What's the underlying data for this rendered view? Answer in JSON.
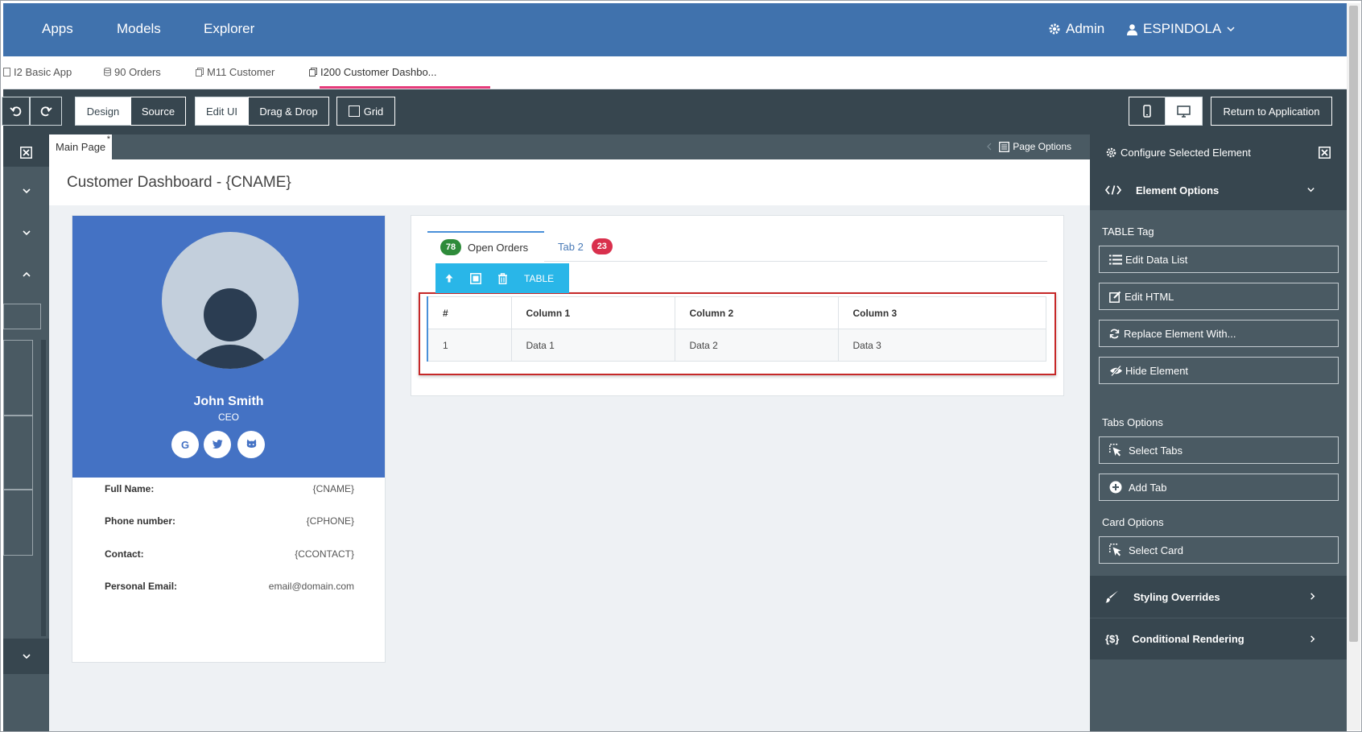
{
  "topnav": {
    "items": [
      "Apps",
      "Models",
      "Explorer"
    ],
    "admin_label": "Admin",
    "user_label": "ESPINDOLA"
  },
  "file_tabs": [
    {
      "label": "I2 Basic App",
      "icon": "file-icon"
    },
    {
      "label": "90 Orders",
      "icon": "database-icon"
    },
    {
      "label": "M11 Customer",
      "icon": "file-icon"
    },
    {
      "label": "I200 Customer Dashbo...",
      "icon": "file-icon",
      "active": true
    }
  ],
  "toolbar": {
    "design": "Design",
    "source": "Source",
    "edit_ui": "Edit UI",
    "drag_drop": "Drag & Drop",
    "grid": "Grid",
    "return": "Return to Application"
  },
  "page": {
    "tab_label": "Main Page",
    "tab_marker": "*",
    "page_options": "Page Options",
    "title": "Customer Dashboard - {CNAME}"
  },
  "profile": {
    "name": "John Smith",
    "role": "CEO",
    "social": [
      "google-icon",
      "twitter-icon",
      "github-icon"
    ],
    "social_glyphs": [
      "G",
      "🐦",
      "◉"
    ],
    "fields": [
      {
        "label": "Full Name:",
        "value": "{CNAME}"
      },
      {
        "label": "Phone number:",
        "value": "{CPHONE}"
      },
      {
        "label": "Contact:",
        "value": "{CCONTACT}"
      },
      {
        "label": "Personal Email:",
        "value": "email@domain.com"
      }
    ]
  },
  "tabs": {
    "open_count": "78",
    "open_label": "Open Orders",
    "tab2_label": "Tab 2",
    "tab2_count": "23"
  },
  "element_toolbar": {
    "tag": "TABLE"
  },
  "table": {
    "headers": [
      "#",
      "Column 1",
      "Column 2",
      "Column 3"
    ],
    "rows": [
      [
        "1",
        "Data 1",
        "Data 2",
        "Data 3"
      ]
    ]
  },
  "rpanel": {
    "title": "Configure Selected Element",
    "element_options": "Element Options",
    "table_tag": "TABLE Tag",
    "edit_data_list": "Edit Data List",
    "edit_html": "Edit HTML",
    "replace": "Replace Element With...",
    "hide": "Hide Element",
    "tabs_options": "Tabs Options",
    "select_tabs": "Select Tabs",
    "add_tab": "Add Tab",
    "card_options": "Card Options",
    "select_card": "Select Card",
    "styling": "Styling Overrides",
    "conditional": "Conditional Rendering"
  },
  "colors": {
    "nav_blue": "#4072ad",
    "toolbar_dark": "#37464f",
    "panel_gray": "#4a5a63",
    "profile_blue": "#4472c4",
    "tab_underline": "#e63b7a",
    "element_toolbar": "#29b6e8",
    "selection_red": "#c62828",
    "badge_green": "#2e8b3a",
    "badge_red": "#d9304d"
  }
}
